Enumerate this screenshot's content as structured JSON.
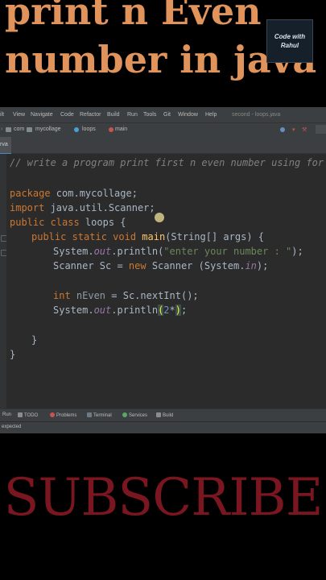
{
  "video": {
    "title_line1": "print n Even",
    "title_line2": "number in java",
    "badge_line1": "Code with",
    "badge_line2": "Rahul",
    "subscribe": "SUBSCRIBE"
  },
  "colors": {
    "title": "#e0945c",
    "subscribe": "#7a1620",
    "editor_bg": "#2b2b2b",
    "keyword": "#cc7832",
    "string": "#6a8759",
    "comment": "#808080"
  },
  "ide": {
    "menu": [
      "ilt",
      "View",
      "Navigate",
      "Code",
      "Refactor",
      "Build",
      "Run",
      "Tools",
      "Git",
      "Window",
      "Help"
    ],
    "window_title": "second - loops.java",
    "breadcrumbs": [
      "com",
      "mycollage",
      "loops",
      "main"
    ],
    "tab_label": "rva",
    "code": {
      "comment": "// write a program print first n even number using for loo",
      "package_kw": "package",
      "package_name": " com.mycollage;",
      "import_kw": "import",
      "import_name": " java.util.Scanner;",
      "class_kw": "public class",
      "class_name": " loops {",
      "main_kw": "public static void",
      "main_name": "main",
      "main_args": "(String[] args) {",
      "l1_a": "System.",
      "l1_out": "out",
      "l1_b": ".println(",
      "l1_str": "\"enter your number : \"",
      "l1_c": ");",
      "l2_a": "Scanner Sc = ",
      "l2_new": "new",
      "l2_b": " Scanner (System.",
      "l2_in": "in",
      "l2_c": ");",
      "l3_kw": "int",
      "l3_var": " nEven",
      "l3_b": " = Sc.nextInt();",
      "l4_a": "System.",
      "l4_out": "out",
      "l4_b": ".println",
      "l4_p1": "(",
      "l4_num": "2",
      "l4_star": "*",
      "l4_p2": ")",
      "l4_c": ";",
      "close_method": "}",
      "close_class": "}"
    },
    "toolbar": [
      "Run",
      "TODO",
      "Problems",
      "Terminal",
      "Services",
      "Build"
    ],
    "status": "expected"
  }
}
